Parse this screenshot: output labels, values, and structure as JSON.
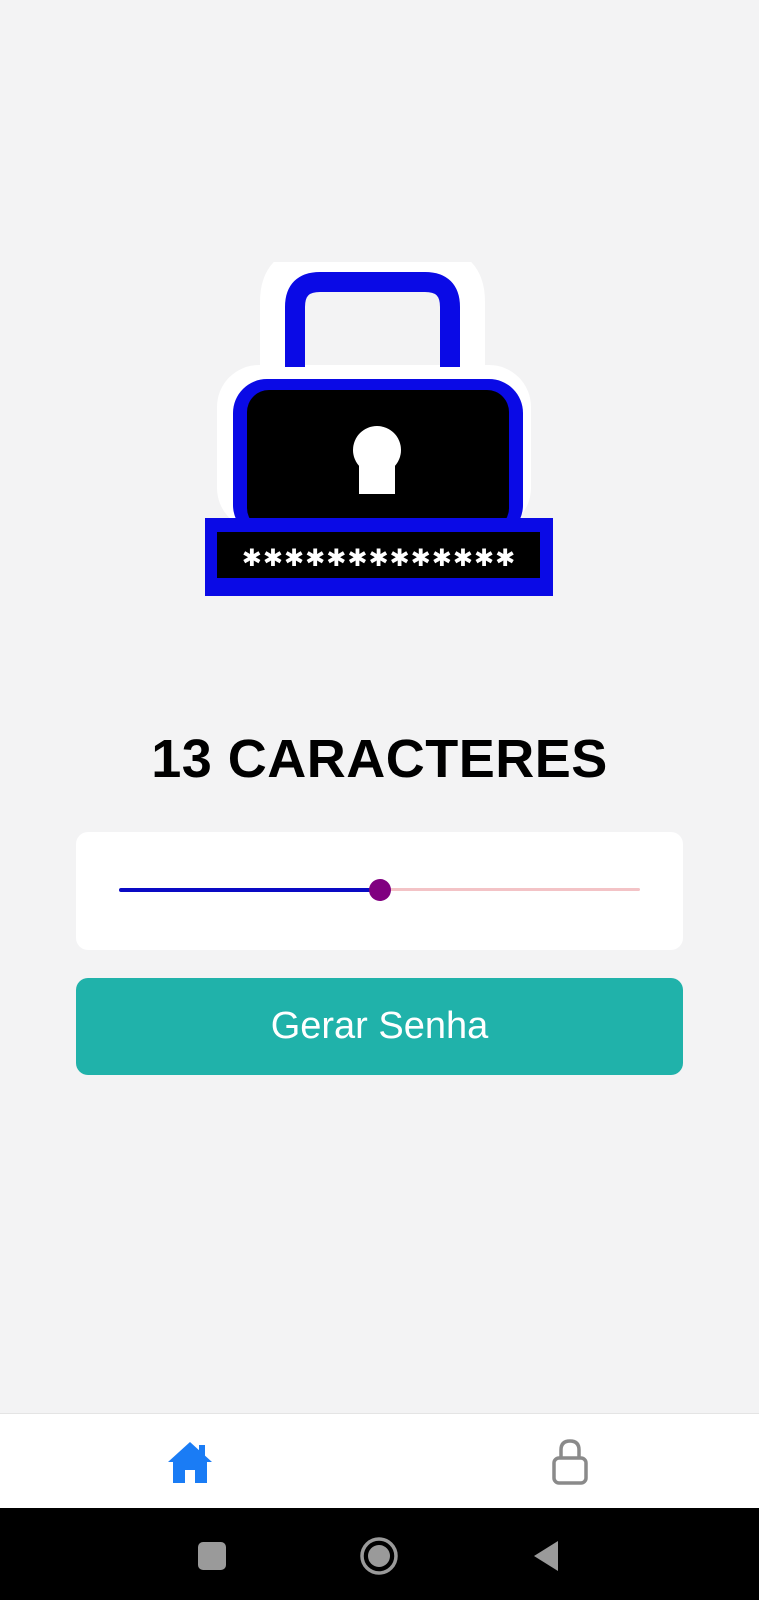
{
  "app": {
    "logo_icon": "padlock-password-icon",
    "logo_password_mask": "✱✱✱✱✱✱✱✱✱✱✱✱✱"
  },
  "main": {
    "length_label": "13 CARACTERES",
    "slider": {
      "value": 13,
      "fill_fraction": 0.5,
      "active_color": "#0a0ac4",
      "inactive_color": "#f3c3c6",
      "thumb_color": "#800080"
    },
    "generate_button": {
      "label": "Gerar Senha",
      "color": "#20b2aa"
    }
  },
  "tabbar": {
    "tabs": [
      {
        "icon": "home-icon",
        "active": true,
        "color": "#1a7cf5"
      },
      {
        "icon": "lock-icon",
        "active": false,
        "color": "#8a8a8a"
      }
    ]
  },
  "system_nav": {
    "buttons": [
      "recents-icon",
      "home-circle-icon",
      "back-icon"
    ]
  }
}
